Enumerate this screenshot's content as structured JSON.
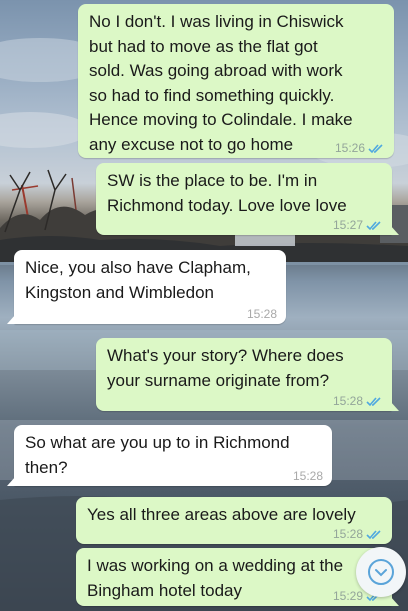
{
  "messages": [
    {
      "direction": "outgoing",
      "text": "No I don't. I was living in Chiswick\nbut had to move as the flat got\nsold. Was going abroad with work\nso had to find something quickly.\nHence moving to Colindale. I make\nany excuse not to go home",
      "time": "15:26",
      "status": "read"
    },
    {
      "direction": "outgoing",
      "text": "SW is the place to be. I'm in\nRichmond today. Love love love",
      "time": "15:27",
      "status": "read"
    },
    {
      "direction": "incoming",
      "text": "Nice, you also have Clapham,\nKingston and Wimbledon",
      "time": "15:28"
    },
    {
      "direction": "outgoing",
      "text": "What's your story? Where does\nyour surname originate from?",
      "time": "15:28",
      "status": "read"
    },
    {
      "direction": "incoming",
      "text": "So what are you up to in Richmond\nthen?",
      "time": "15:28"
    },
    {
      "direction": "outgoing",
      "text": "Yes all three areas above are lovely",
      "time": "15:28",
      "status": "read"
    },
    {
      "direction": "outgoing",
      "text": "I was working on a wedding at the\nBingham hotel today",
      "time": "15:29",
      "status": "read"
    }
  ],
  "icons": {
    "read_receipt": "double-check-icon",
    "scroll_down": "chevron-down-icon"
  },
  "colors": {
    "outgoing_bubble": "#dcf8c6",
    "incoming_bubble": "#ffffff",
    "read_tick": "#4fa8e0",
    "timestamp": "#93a59a"
  }
}
